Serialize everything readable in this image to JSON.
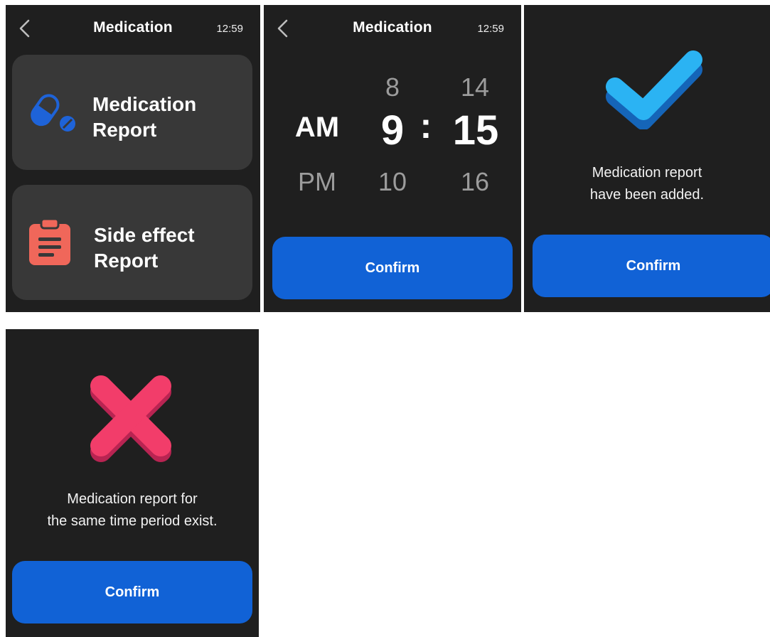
{
  "header": {
    "title": "Medication",
    "time": "12:59"
  },
  "menu": {
    "medication_report": {
      "line1": "Medication",
      "line2": "Report"
    },
    "side_effect_report": {
      "line1": "Side effect",
      "line2": "Report"
    }
  },
  "time_picker": {
    "ampm": {
      "selected": "AM",
      "below": "PM"
    },
    "hour": {
      "above": "8",
      "selected": "9",
      "below": "10"
    },
    "separator": ":",
    "minute": {
      "above": "14",
      "selected": "15",
      "below": "16"
    }
  },
  "success": {
    "message_line1": "Medication report",
    "message_line2": "have been added."
  },
  "error": {
    "message_line1": "Medication report for",
    "message_line2": "the same time period exist."
  },
  "confirm_label": "Confirm",
  "icons": {
    "back": "chevron-left-icon",
    "pill": "pill-icon",
    "clipboard": "clipboard-icon",
    "check": "checkmark-icon",
    "cross": "cross-icon"
  },
  "colors": {
    "screen_bg": "#1f1f1f",
    "card_bg": "#383838",
    "accent_blue": "#1162d6",
    "pill_blue": "#1e63d8",
    "clipboard_coral": "#f0675a",
    "check_blue": "#2bb3f3",
    "cross_pink": "#f23d6a"
  }
}
